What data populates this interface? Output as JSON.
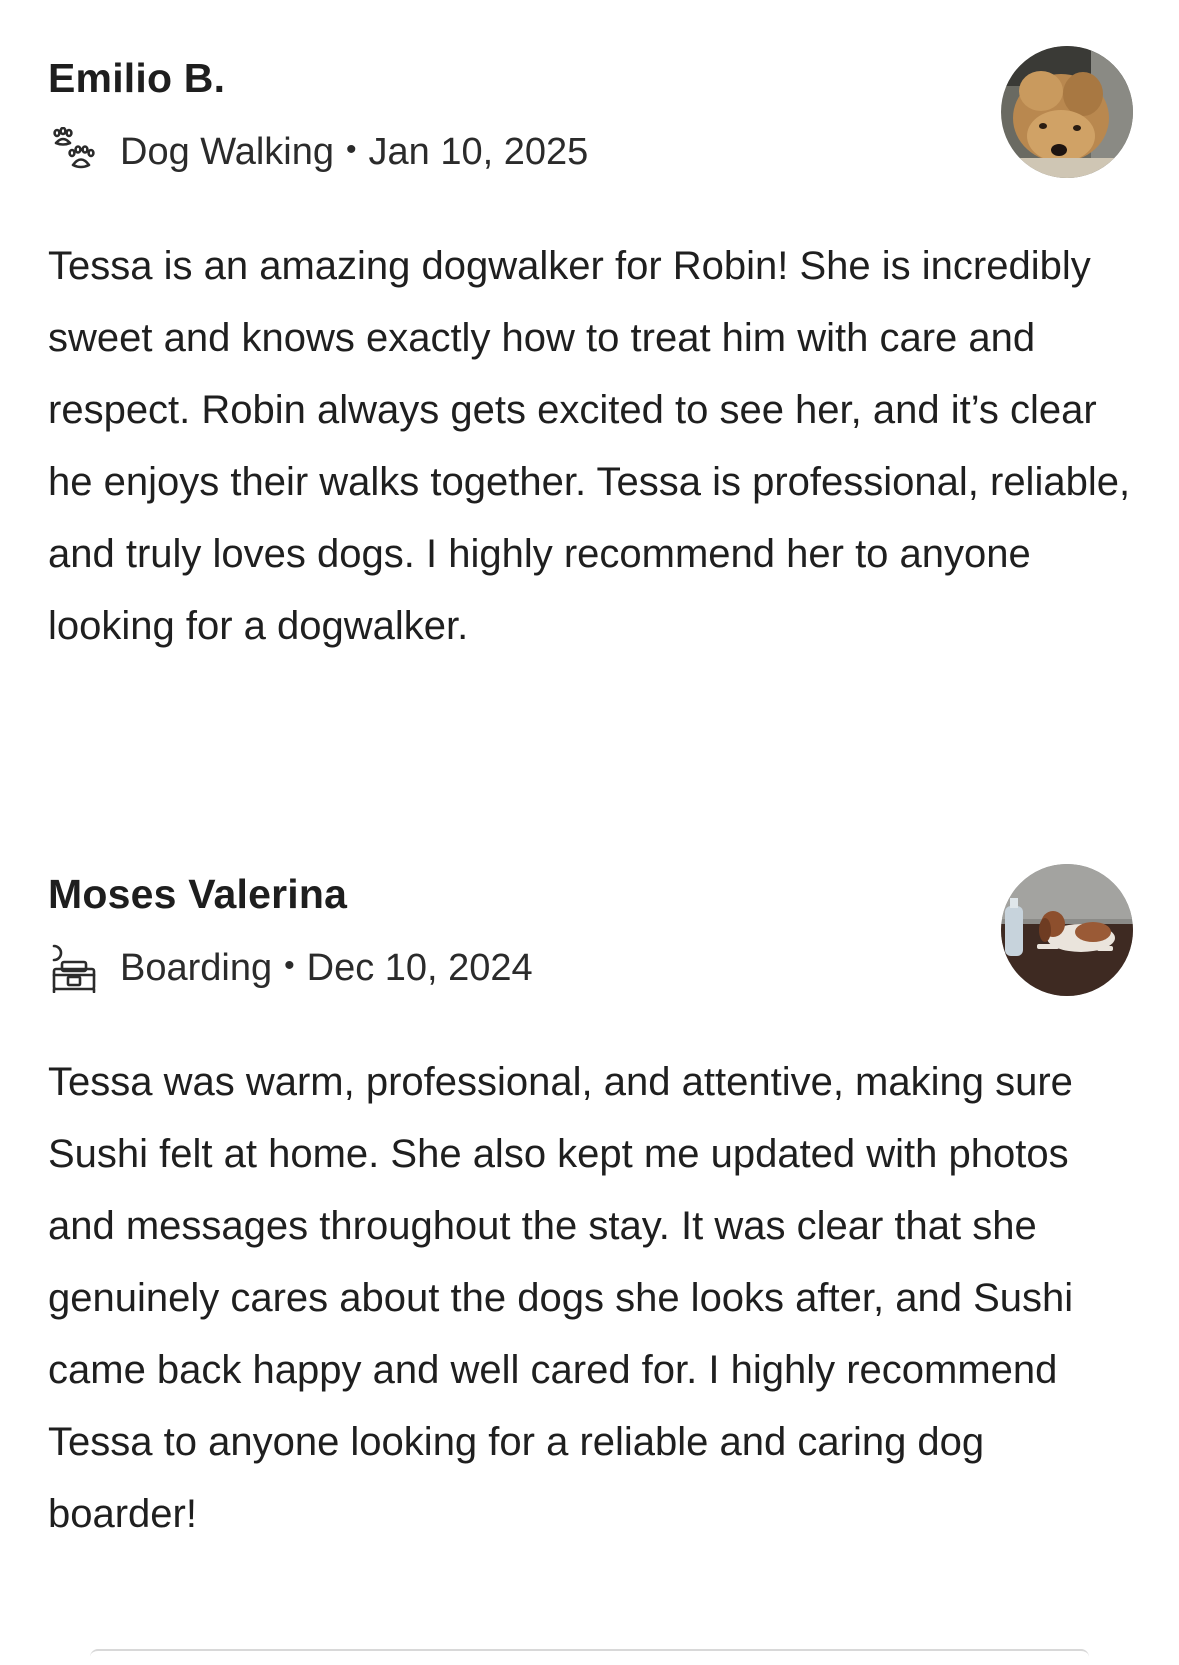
{
  "reviews": [
    {
      "name": "Emilio B.",
      "service": "Dog Walking",
      "service_icon": "paw-icon",
      "separator": "•",
      "date": "Jan 10, 2025",
      "text": "Tessa is an amazing dogwalker for Robin! She is incredibly sweet and knows exactly how to treat him with care and respect. Robin always gets excited to see her, and it’s clear he enjoys their walks together. Tessa is professional, reliable, and truly loves dogs. I highly recommend her to anyone looking for a dogwalker."
    },
    {
      "name": "Moses Valerina",
      "service": "Boarding",
      "service_icon": "boarding-icon",
      "separator": "•",
      "date": "Dec 10, 2024",
      "text": "Tessa was warm, professional, and attentive, making sure Sushi felt at home. She also kept me updated with photos and messages throughout the stay. It was clear that she genuinely cares about the dogs she looks after, and Sushi came back happy and well cared for. I highly recommend Tessa to anyone looking for a reliable and caring dog boarder!"
    }
  ],
  "colors": {
    "text": "#1e1e1e",
    "background": "#ffffff"
  }
}
